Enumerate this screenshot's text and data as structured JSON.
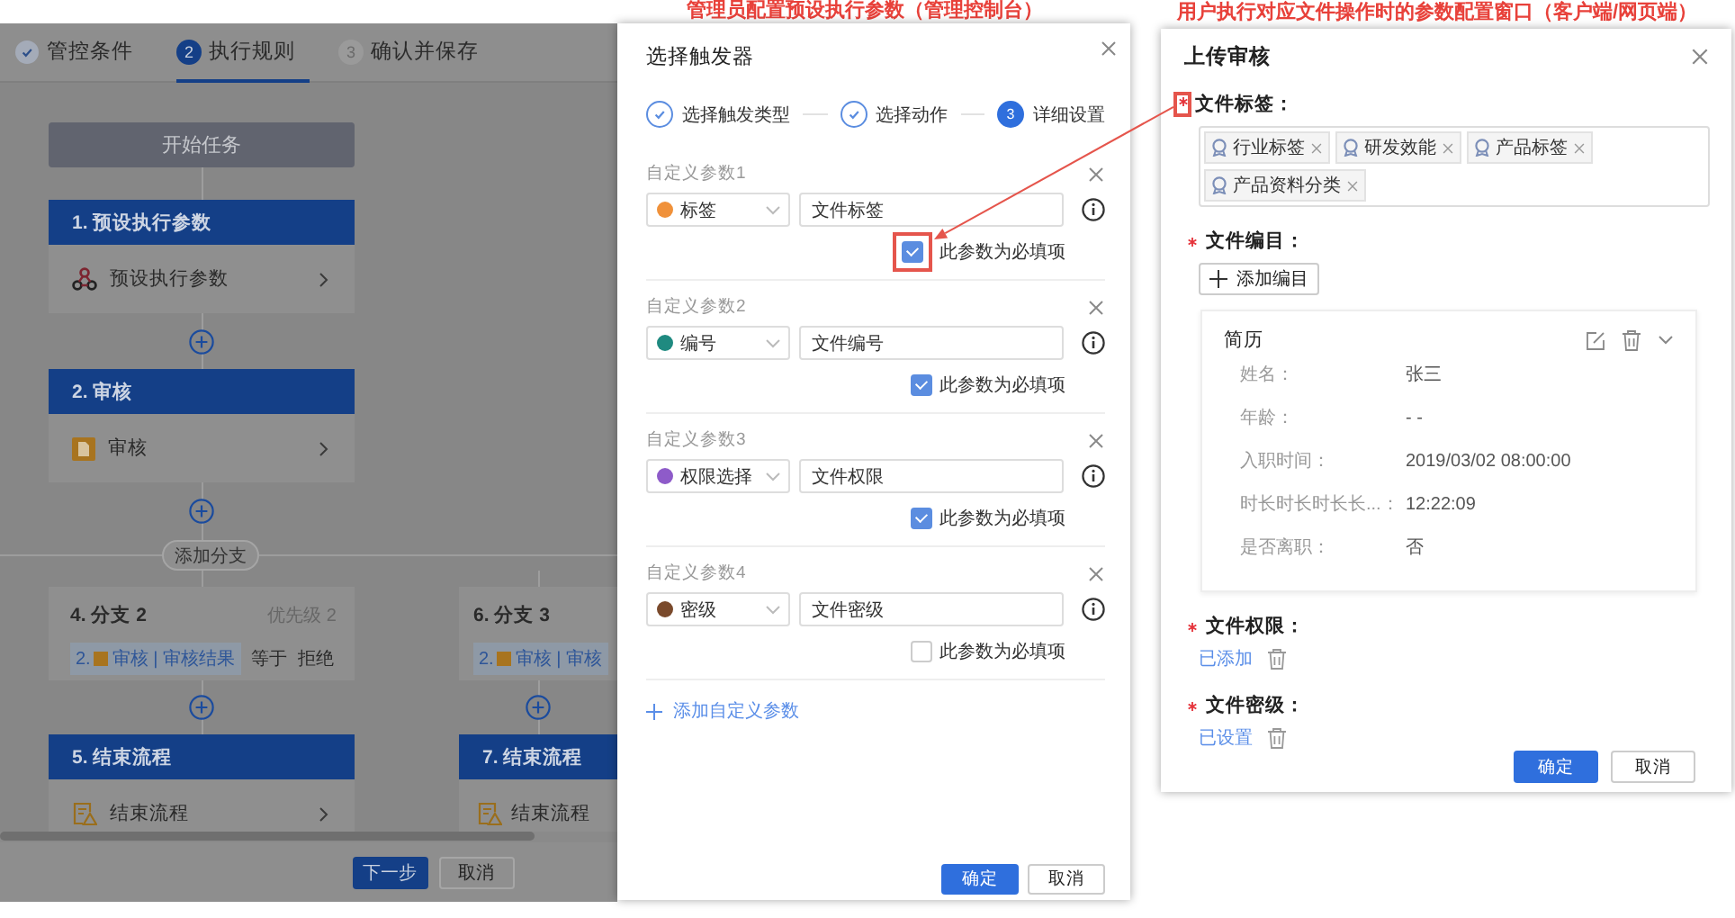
{
  "workflow_editor": {
    "steps": [
      {
        "label": "管控条件",
        "completed": true,
        "selected": false
      },
      {
        "number": "2",
        "label": "执行规则",
        "completed": false,
        "selected": true
      },
      {
        "number": "3",
        "label": "确认并保存",
        "completed": false,
        "selected": false
      }
    ],
    "start_node": "开始任务",
    "nodes": [
      {
        "title": "1. 预设执行参数",
        "item": "预设执行参数",
        "kind": "params"
      },
      {
        "title": "2. 审核",
        "item": "审核",
        "kind": "review"
      }
    ],
    "add_branch": "添加分支",
    "branches": [
      {
        "title": "4. 分支 2",
        "priority": "优先级 2",
        "condition": {
          "ref_number": "2.",
          "ref": "审核 | 审核结果",
          "operator": "等于",
          "value": "拒绝"
        },
        "end_node": {
          "title": "5. 结束流程",
          "item": "结束流程",
          "kind": "end"
        }
      },
      {
        "title": "6. 分支 3",
        "condition": {
          "ref_number": "2.",
          "ref": "审核 | 审核"
        },
        "end_node": {
          "title": "7. 结束流程",
          "item": "结束流程",
          "kind": "end"
        }
      }
    ],
    "buttons": [
      {
        "label": "下一步",
        "kind": "primary"
      },
      {
        "label": "取消",
        "kind": "default"
      }
    ]
  },
  "trigger_dialog": {
    "caption": "管理员配置预设执行参数（管理控制台）",
    "title": "选择触发器",
    "steps": [
      {
        "label": "选择触发类型",
        "completed": true
      },
      {
        "label": "选择动作",
        "completed": true
      },
      {
        "number": "3",
        "label": "详细设置",
        "completed": false
      }
    ],
    "params": [
      {
        "label": "自定义参数1",
        "type": "标签",
        "color": "#f0913a",
        "value": "文件标签",
        "required_label": "此参数为必填项",
        "checked": true,
        "highlighted": true
      },
      {
        "label": "自定义参数2",
        "type": "编号",
        "color": "#1f8a80",
        "value": "文件编号",
        "required_label": "此参数为必填项",
        "checked": true
      },
      {
        "label": "自定义参数3",
        "type": "权限选择",
        "color": "#8e5bc9",
        "value": "文件权限",
        "required_label": "此参数为必填项",
        "checked": true
      },
      {
        "label": "自定义参数4",
        "type": "密级",
        "color": "#7a4a2c",
        "value": "文件密级",
        "required_label": "此参数为必填项",
        "checked": false
      }
    ],
    "add_param": "添加自定义参数",
    "buttons": [
      {
        "label": "确定",
        "kind": "primary"
      },
      {
        "label": "取消",
        "kind": "default"
      }
    ]
  },
  "upload_dialog": {
    "caption": "用户执行对应文件操作时的参数配置窗口（客户端/网页端）",
    "title": "上传审核",
    "fields": [
      {
        "kind": "tags",
        "label": "文件标签：",
        "required": true,
        "highlighted": true,
        "tags": [
          "行业标签",
          "研发效能",
          "产品标签",
          "产品资料分类"
        ]
      },
      {
        "kind": "catalog",
        "label": "文件编目：",
        "required": true,
        "button": "添加编目",
        "card": {
          "title": "简历",
          "rows": [
            {
              "label": "姓名：",
              "value": "张三"
            },
            {
              "label": "年龄：",
              "value": "- -"
            },
            {
              "label": "入职时间：",
              "value": "2019/03/02  08:00:00"
            },
            {
              "label": "时长时长时长长...：",
              "value": "12:22:09"
            },
            {
              "label": "是否离职：",
              "value": "否"
            }
          ]
        }
      },
      {
        "kind": "link",
        "label": "文件权限：",
        "required": true,
        "link": "已添加"
      },
      {
        "kind": "link",
        "label": "文件密级：",
        "required": true,
        "link": "已设置"
      }
    ],
    "buttons": [
      {
        "label": "确定",
        "kind": "primary"
      },
      {
        "label": "取消",
        "kind": "default"
      }
    ]
  }
}
